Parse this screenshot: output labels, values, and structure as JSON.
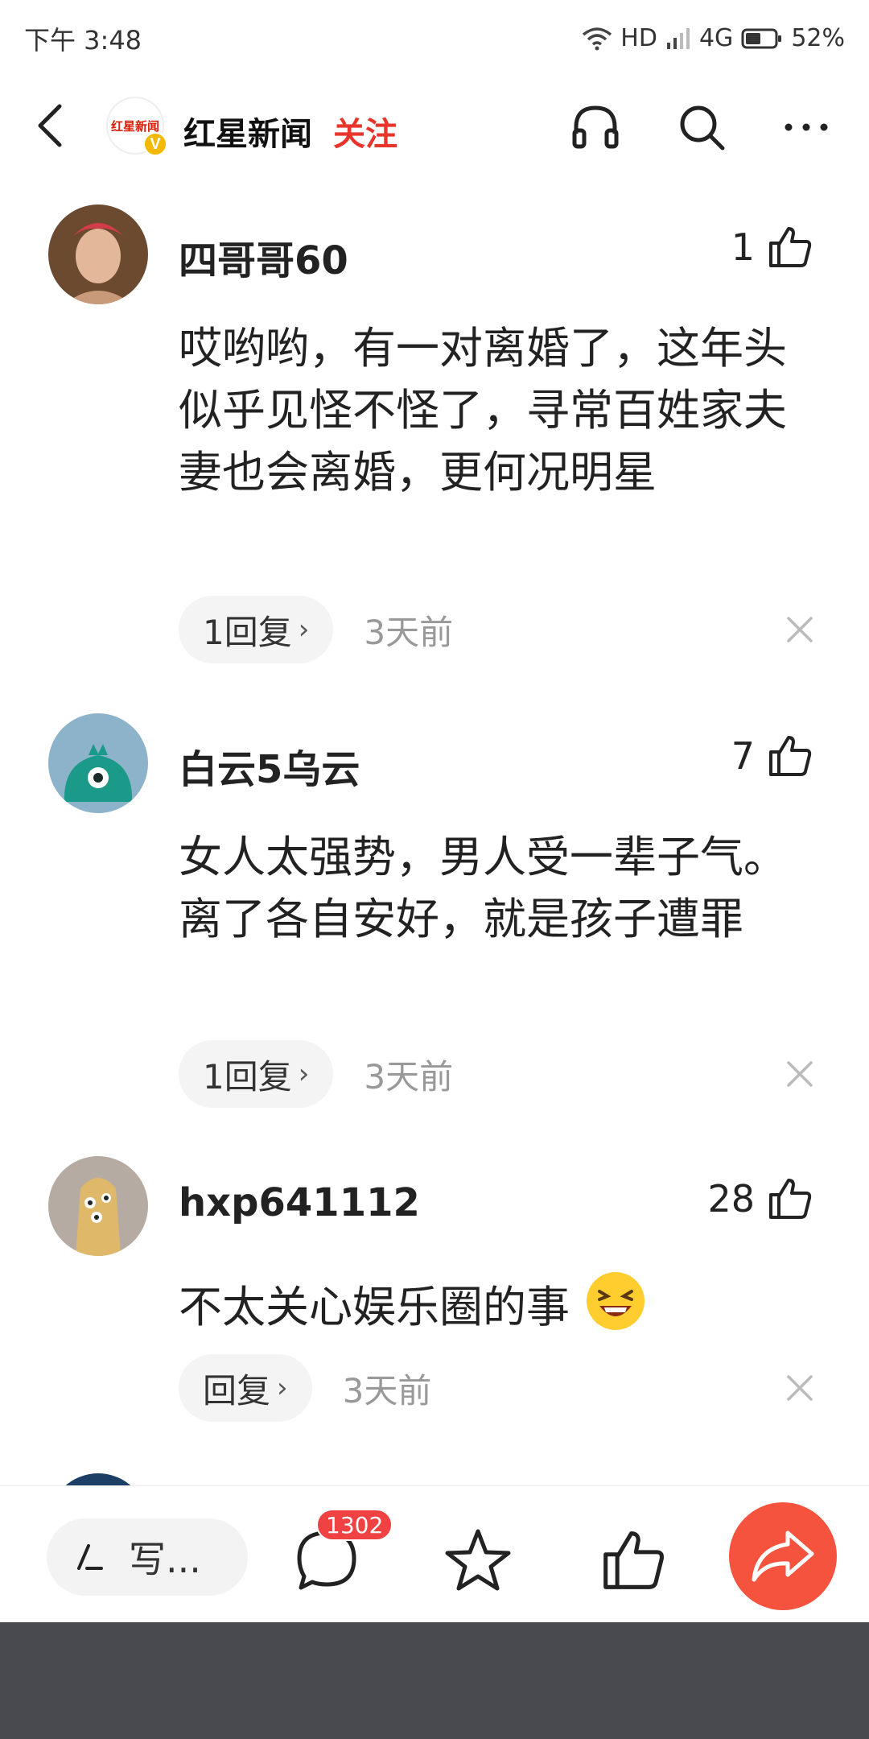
{
  "status_bar": {
    "time": "下午 3:48",
    "hd": "HD",
    "network": "4G",
    "battery": "52%"
  },
  "header": {
    "logo_text": "红星新闻",
    "logo_badge": "V",
    "channel_name": "红星新闻",
    "follow_label": "关注"
  },
  "comments": [
    {
      "username": "四哥哥60",
      "likes": "1",
      "text": "哎哟哟，有一对离婚了，这年头似乎见怪不怪了，寻常百姓家夫妻也会离婚，更何况明星",
      "reply_label": "1回复",
      "time": "3天前"
    },
    {
      "username": "白云5乌云",
      "likes": "7",
      "text": "女人太强势，男人受一辈子气。离了各自安好，就是孩子遭罪",
      "reply_label": "1回复",
      "time": "3天前"
    },
    {
      "username": "hxp641112",
      "likes": "28",
      "text": "不太关心娱乐圈的事",
      "emoji": "laughing-emoji",
      "reply_label": "回复",
      "time": "3天前"
    }
  ],
  "bottom_bar": {
    "write_placeholder": "写...",
    "comment_count": "1302"
  },
  "colors": {
    "accent_red": "#e8352b",
    "share_orange": "#f5533d",
    "badge_red": "#f04242",
    "verified_yellow": "#f5b800"
  }
}
